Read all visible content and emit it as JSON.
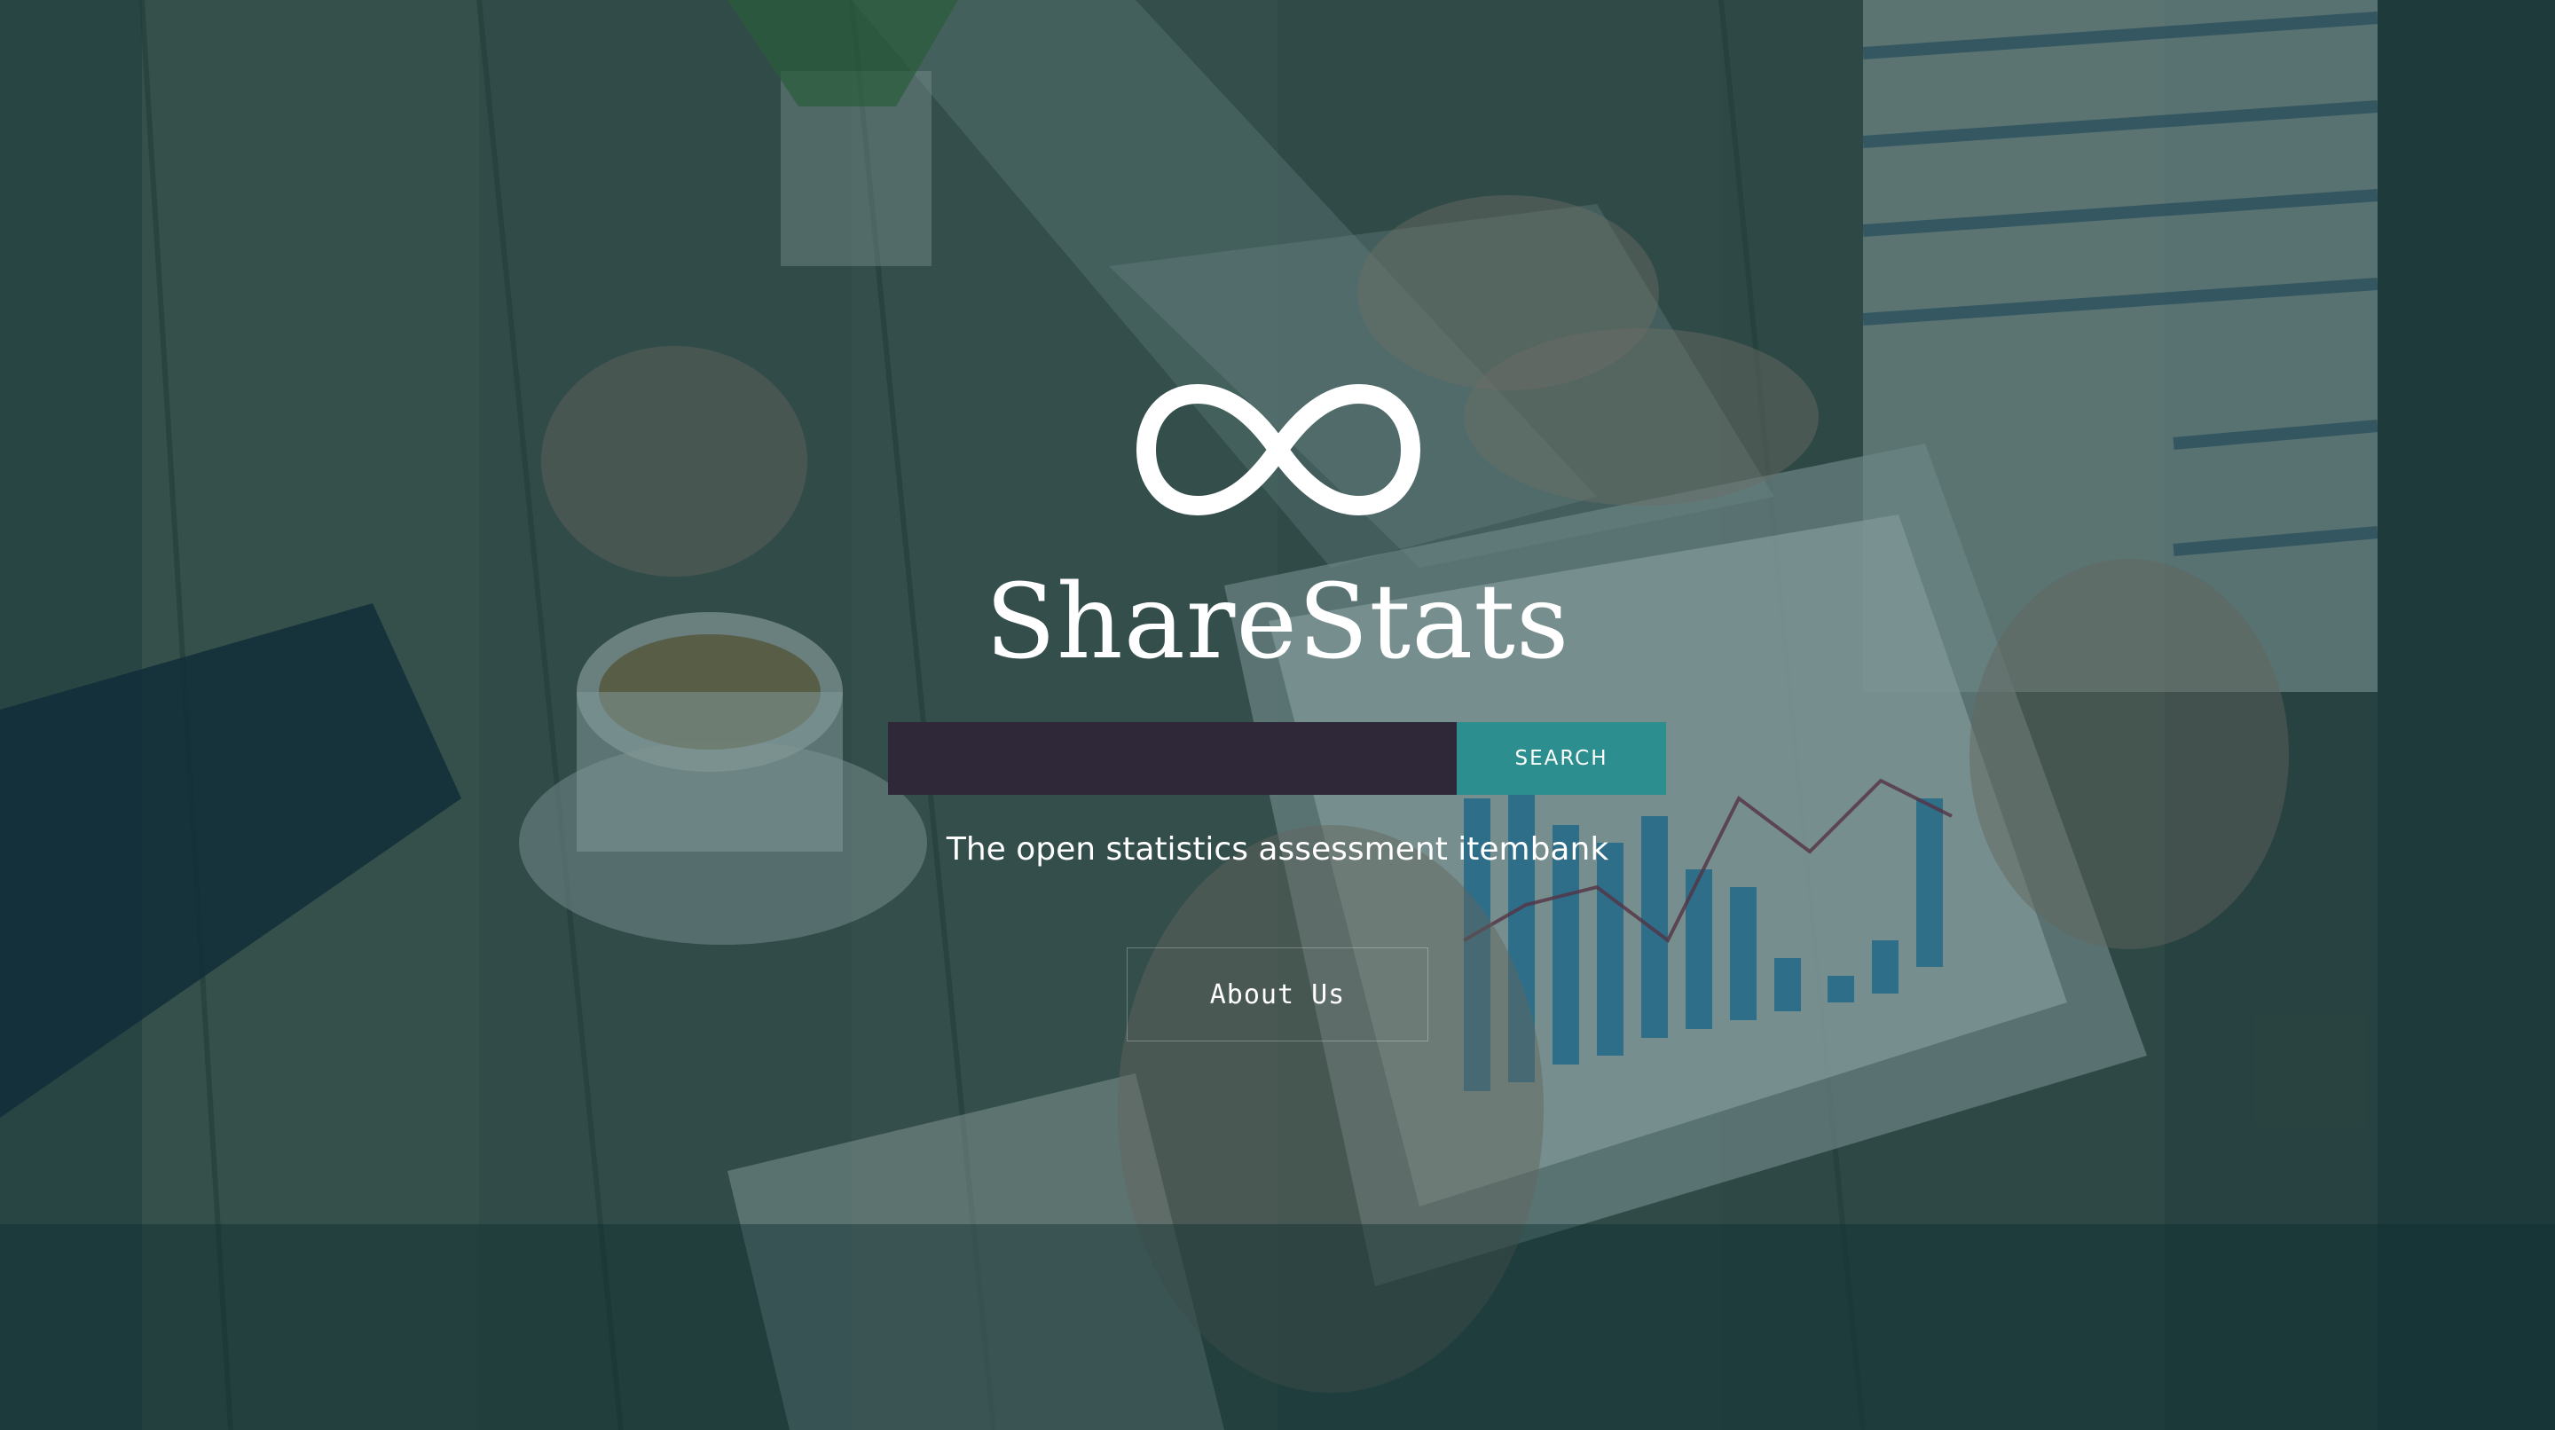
{
  "brand": {
    "title": "ShareStats",
    "logo_icon": "infinity-icon"
  },
  "search": {
    "value": "",
    "placeholder": "",
    "button_label": "SEARCH"
  },
  "tagline": "The open statistics assessment itembank",
  "about": {
    "label": "About Us"
  },
  "colors": {
    "overlay": "#0e383a",
    "search_input_bg": "#2f2838",
    "search_button_bg": "#2c8e8e",
    "text": "#ffffff"
  }
}
